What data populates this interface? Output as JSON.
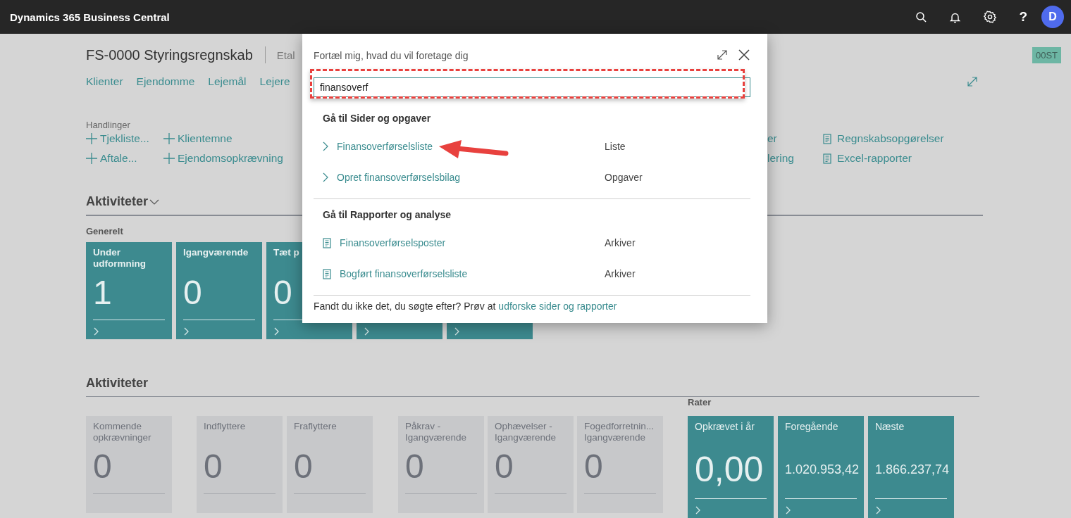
{
  "app_bar": {
    "title": "Dynamics 365 Business Central",
    "help": "?",
    "avatar": "D"
  },
  "page": {
    "title": "FS-0000 Styringsregnskab",
    "title_extra": "Etal",
    "badge": "00ST",
    "nav": [
      "Klienter",
      "Ejendomme",
      "Lejemål",
      "Lejere"
    ]
  },
  "actions": {
    "label": "Handlinger",
    "columns": [
      {
        "kind": "new",
        "items": [
          "Tjekliste...",
          "Aftale..."
        ]
      },
      {
        "kind": "new",
        "items": [
          "Klientemne",
          "Ejendomsopkrævning"
        ]
      },
      {
        "kind": "plain",
        "items": [
          "er",
          "lering"
        ]
      },
      {
        "kind": "report",
        "items": [
          "Regnskabsopgørelser",
          "Excel-rapporter"
        ]
      }
    ]
  },
  "activities_1": {
    "title": "Aktiviteter",
    "groups": [
      {
        "label": "Generelt",
        "tiles": [
          {
            "kind": "full",
            "title": "Under udformning",
            "value": "1"
          },
          {
            "kind": "full",
            "title": "Igangværende",
            "value": "0"
          },
          {
            "kind": "full",
            "title": "Tæt p",
            "value": "0"
          },
          {
            "kind": "covered"
          },
          {
            "kind": "covered"
          }
        ]
      }
    ]
  },
  "activities_2": {
    "title": "Aktiviteter",
    "groups": [
      {
        "kind": "inactive",
        "tiles": [
          {
            "title": "Kommende opkrævninger",
            "value": "0"
          }
        ]
      },
      {
        "kind": "inactive",
        "tiles": [
          {
            "title": "Indflyttere",
            "value": "0"
          },
          {
            "title": "Fraflyttere",
            "value": "0"
          }
        ]
      },
      {
        "kind": "inactive",
        "tiles": [
          {
            "title": "Påkrav - Igangværende",
            "value": "0"
          },
          {
            "title": "Ophævelser - Igangværende",
            "value": "0"
          },
          {
            "title": "Fogedforretnin... Igangværende",
            "value": "0"
          }
        ]
      },
      {
        "kind": "active",
        "label": "Rater",
        "tiles": [
          {
            "title": "Opkrævet i år",
            "value": "0,00"
          },
          {
            "title": "Foregående",
            "value": "1.020.953,42"
          },
          {
            "title": "Næste",
            "value": "1.866.237,74"
          }
        ]
      }
    ]
  },
  "dialog": {
    "prompt": "Fortæl mig, hvad du vil foretage dig",
    "search_value": "finansoverf",
    "sections": [
      {
        "heading": "Gå til Sider og opgaver",
        "results": [
          {
            "kind": "page",
            "label": "Finansoverførselsliste",
            "category": "Liste"
          },
          {
            "kind": "page",
            "label": "Opret finansoverførselsbilag",
            "category": "Opgaver"
          }
        ]
      },
      {
        "heading": "Gå til Rapporter og analyse",
        "results": [
          {
            "kind": "report",
            "label": "Finansoverførselsposter",
            "category": "Arkiver"
          },
          {
            "kind": "report",
            "label": "Bogført finansoverførselsliste",
            "category": "Arkiver"
          }
        ]
      }
    ],
    "footer_text": "Fandt du ikke det, du søgte efter? Prøv at",
    "footer_link": "udforske sider og rapporter"
  }
}
